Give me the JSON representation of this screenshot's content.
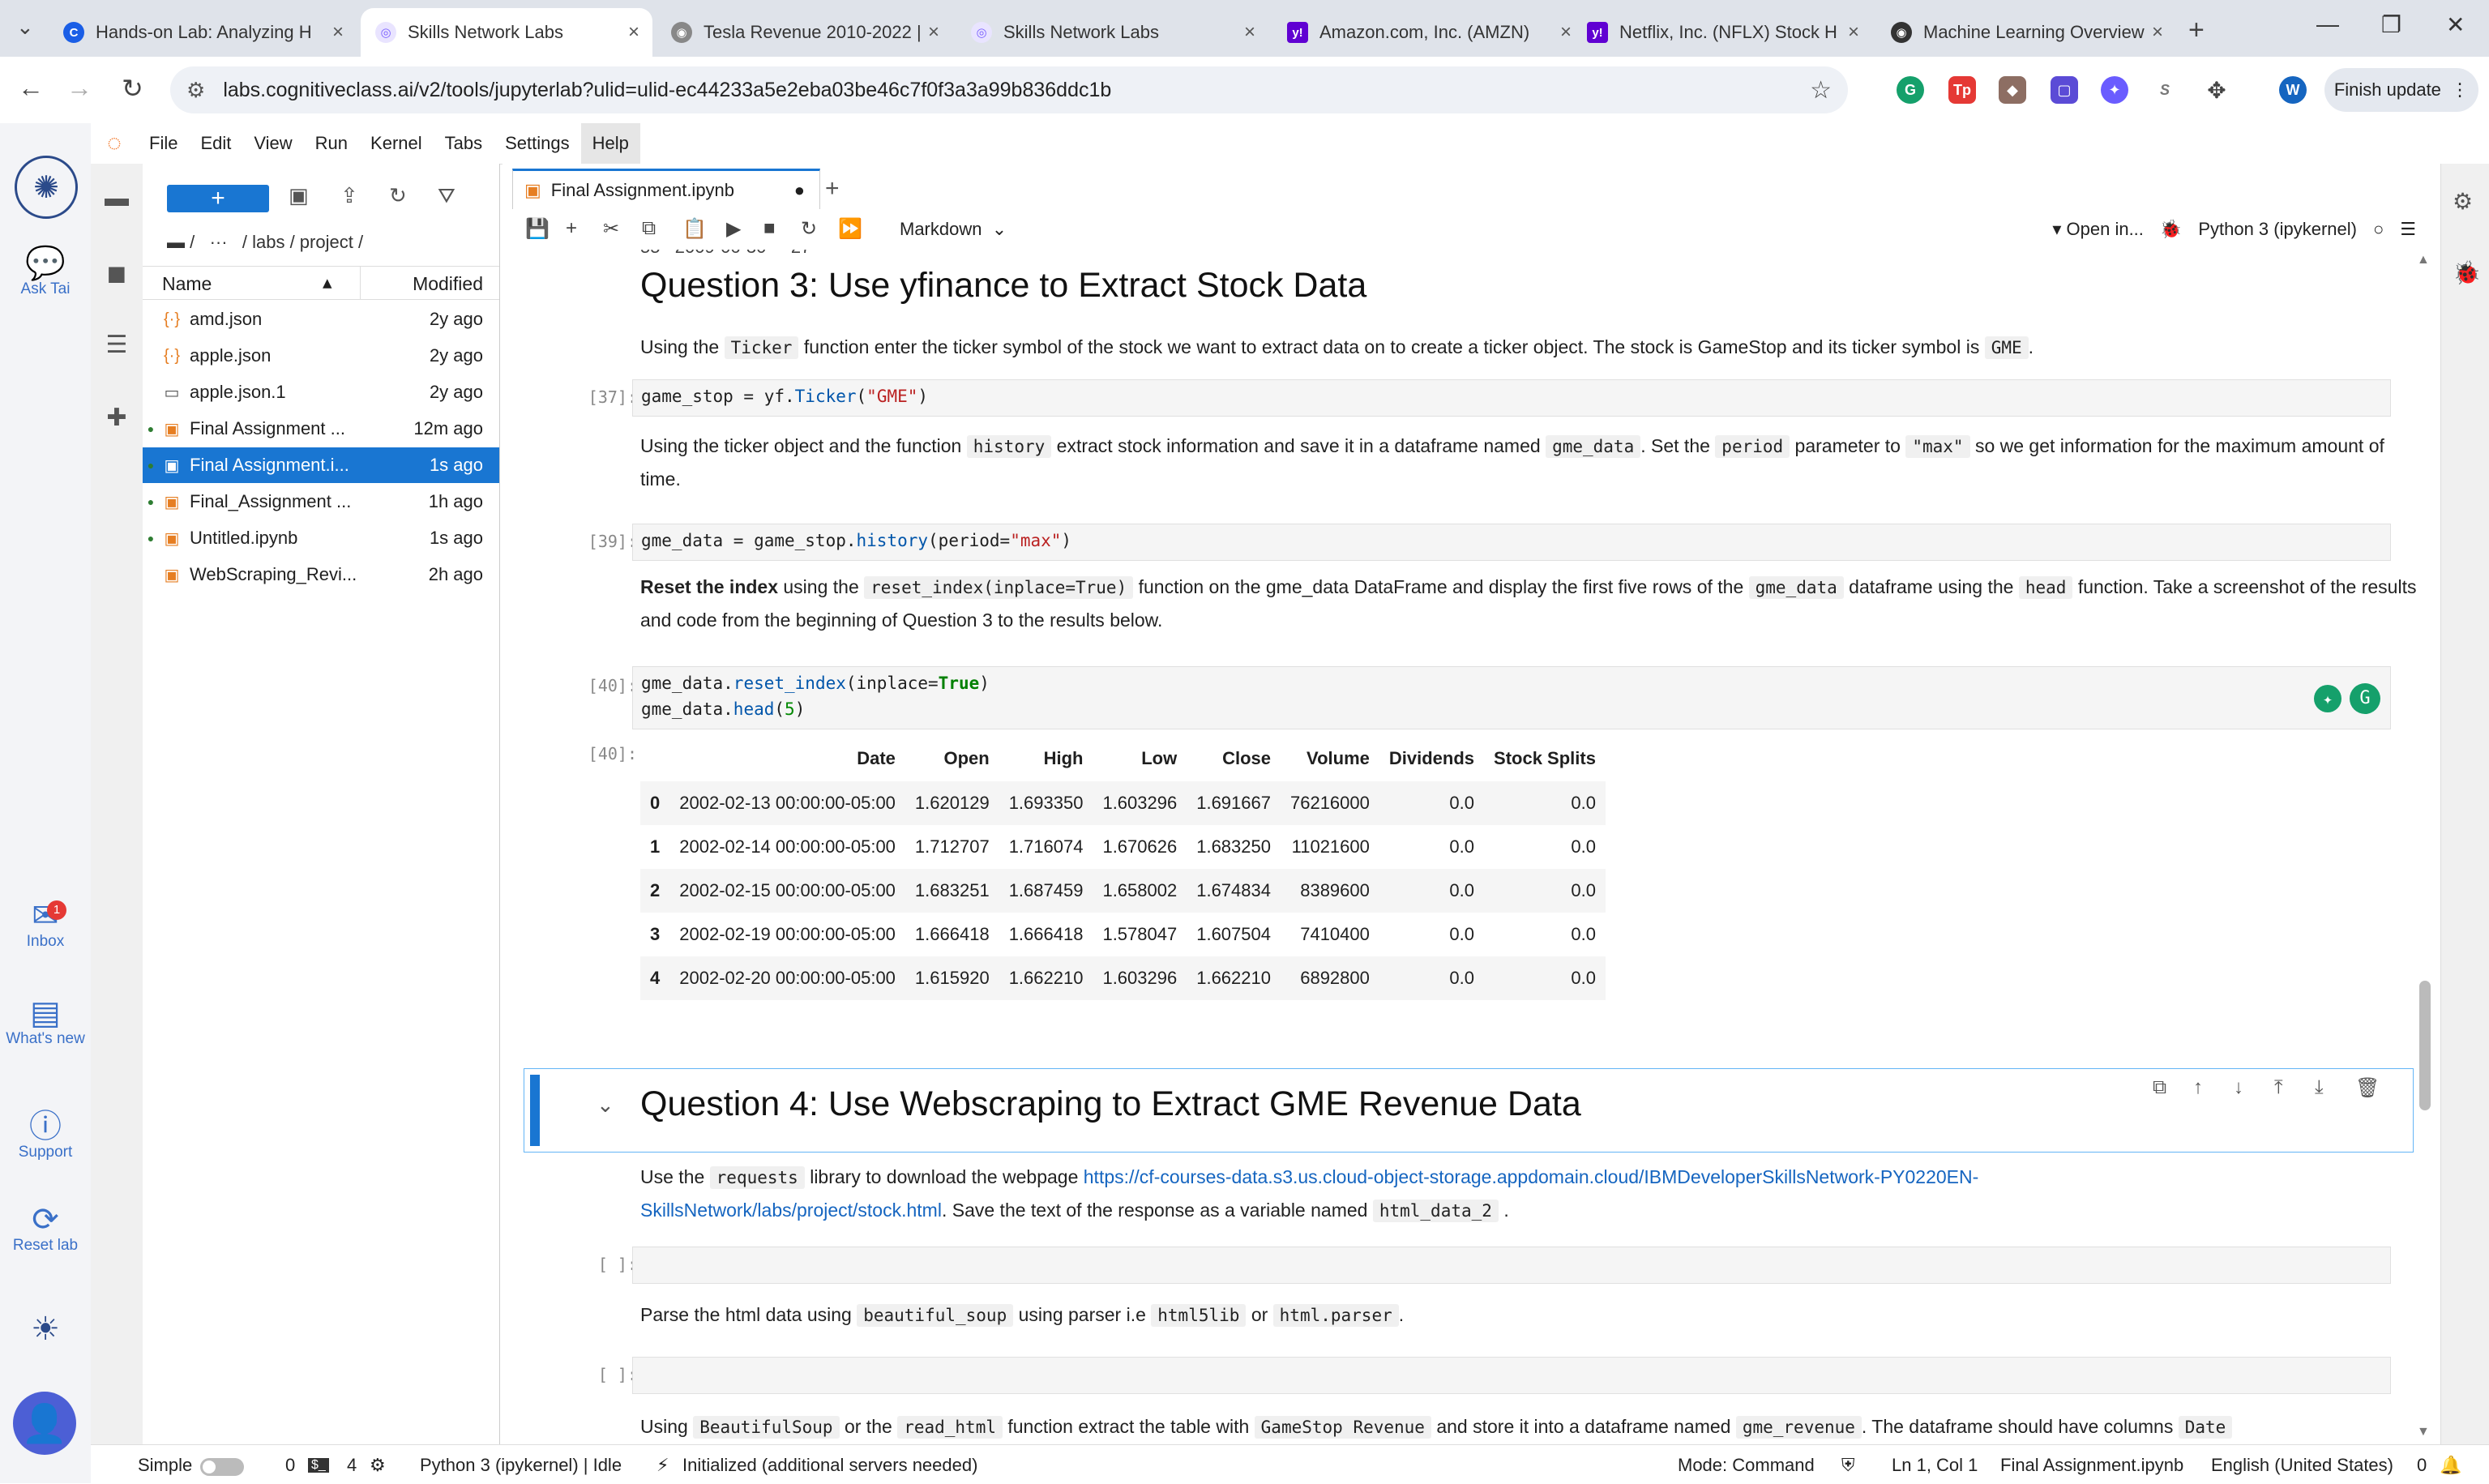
{
  "browser": {
    "tabs": [
      {
        "title": "Hands-on Lab: Analyzing H",
        "favicon": "C",
        "color": "#1a5ee6"
      },
      {
        "title": "Skills Network Labs",
        "favicon": "◎",
        "color": "#7b61ff",
        "active": true
      },
      {
        "title": "Tesla Revenue 2010-2022 |",
        "favicon": "◉",
        "color": "#666666"
      },
      {
        "title": "Skills Network Labs",
        "favicon": "◎",
        "color": "#7b61ff"
      },
      {
        "title": "Amazon.com, Inc. (AMZN)",
        "favicon": "y!",
        "color": "#6001d2"
      },
      {
        "title": "Netflix, Inc. (NFLX) Stock H",
        "favicon": "y!",
        "color": "#6001d2"
      },
      {
        "title": "Machine Learning Overview",
        "favicon": "◉",
        "color": "#222222"
      }
    ],
    "url": "labs.cognitiveclass.ai/v2/tools/jupyterlab?ulid=ulid-ec44233a5e2eba03be46c7f0f3a3a99b836ddc1b",
    "finish_update": "Finish update",
    "profile_initial": "W"
  },
  "rail": {
    "ask": "Ask Tai",
    "inbox": "Inbox",
    "inbox_badge": "1",
    "whats_new": "What's new",
    "support": "Support",
    "reset": "Reset lab"
  },
  "menu": [
    "File",
    "Edit",
    "View",
    "Run",
    "Kernel",
    "Tabs",
    "Settings",
    "Help"
  ],
  "filebrowser": {
    "breadcrumb": "/   ···   / labs / project /",
    "col_name": "Name",
    "col_modified": "Modified",
    "files": [
      {
        "name": "amd.json",
        "modified": "2y ago",
        "type": "json"
      },
      {
        "name": "apple.json",
        "modified": "2y ago",
        "type": "json"
      },
      {
        "name": "apple.json.1",
        "modified": "2y ago",
        "type": "file"
      },
      {
        "name": "Final Assignment ...",
        "modified": "12m ago",
        "type": "nb",
        "running": true
      },
      {
        "name": "Final Assignment.i...",
        "modified": "1s ago",
        "type": "nb",
        "running": true,
        "selected": true
      },
      {
        "name": "Final_Assignment ...",
        "modified": "1h ago",
        "type": "nb",
        "running": true
      },
      {
        "name": "Untitled.ipynb",
        "modified": "1s ago",
        "type": "nb",
        "running": true
      },
      {
        "name": "WebScraping_Revi...",
        "modified": "2h ago",
        "type": "nb"
      }
    ]
  },
  "notebook": {
    "tab_title": "Final Assignment.ipynb",
    "cell_type": "Markdown",
    "open_in": "Open in...",
    "kernel": "Python 3 (ipykernel)",
    "q3_title": "Question 3: Use yfinance to Extract Stock Data",
    "q3_p1_a": "Using the",
    "q3_p1_code1": "Ticker",
    "q3_p1_b": "function enter the ticker symbol of the stock we want to extract data on to create a ticker object. The stock is GameStop and its ticker symbol is",
    "q3_p1_code2": "GME",
    "q3_p1_c": ".",
    "c37_prompt": "[37]:",
    "c37_a": "game_stop = yf.",
    "c37_fn": "Ticker",
    "c37_b": "(",
    "c37_str": "\"GME\"",
    "c37_c": ")",
    "q3_p2_a": "Using the ticker object and the function",
    "q3_p2_code1": "history",
    "q3_p2_b": "extract stock information and save it in a dataframe named",
    "q3_p2_code2": "gme_data",
    "q3_p2_c": ". Set the",
    "q3_p2_code3": "period",
    "q3_p2_d": "parameter to",
    "q3_p2_code4": "\"max\"",
    "q3_p2_e": "so we get information for the maximum amount of time.",
    "c39_prompt": "[39]:",
    "c39_a": "gme_data = game_stop.",
    "c39_fn": "history",
    "c39_b": "(period=",
    "c39_str": "\"max\"",
    "c39_c": ")",
    "q3_p3_bold": "Reset the index",
    "q3_p3_a": "using the",
    "q3_p3_code1": "reset_index(inplace=True)",
    "q3_p3_b": "function on the gme_data DataFrame and display the first five rows of the",
    "q3_p3_code2": "gme_data",
    "q3_p3_c": "dataframe using the",
    "q3_p3_code3": "head",
    "q3_p3_d": "function. Take a screenshot of the results and code from the beginning of Question 3 to the results below.",
    "c40_prompt": "[40]:",
    "c40_l1_a": "gme_data.",
    "c40_l1_fn": "reset_index",
    "c40_l1_b": "(inplace=",
    "c40_l1_kw": "True",
    "c40_l1_c": ")",
    "c40_l2_a": "gme_data.",
    "c40_l2_fn": "head",
    "c40_l2_b": "(",
    "c40_l2_num": "5",
    "c40_l2_c": ")",
    "out40_prompt": "[40]:",
    "table": {
      "columns": [
        "",
        "Date",
        "Open",
        "High",
        "Low",
        "Close",
        "Volume",
        "Dividends",
        "Stock Splits"
      ],
      "rows": [
        [
          "0",
          "2002-02-13 00:00:00-05:00",
          "1.620129",
          "1.693350",
          "1.603296",
          "1.691667",
          "76216000",
          "0.0",
          "0.0"
        ],
        [
          "1",
          "2002-02-14 00:00:00-05:00",
          "1.712707",
          "1.716074",
          "1.670626",
          "1.683250",
          "11021600",
          "0.0",
          "0.0"
        ],
        [
          "2",
          "2002-02-15 00:00:00-05:00",
          "1.683251",
          "1.687459",
          "1.658002",
          "1.674834",
          "8389600",
          "0.0",
          "0.0"
        ],
        [
          "3",
          "2002-02-19 00:00:00-05:00",
          "1.666418",
          "1.666418",
          "1.578047",
          "1.607504",
          "7410400",
          "0.0",
          "0.0"
        ],
        [
          "4",
          "2002-02-20 00:00:00-05:00",
          "1.615920",
          "1.662210",
          "1.603296",
          "1.662210",
          "6892800",
          "0.0",
          "0.0"
        ]
      ]
    },
    "q4_title": "Question 4: Use Webscraping to Extract GME Revenue Data",
    "q4_p1_a": "Use the",
    "q4_p1_code1": "requests",
    "q4_p1_b": "library to download the webpage",
    "q4_p1_link1": "https://cf-courses-data.s3.us.cloud-object-storage.appdomain.cloud/IBMDeveloperSkillsNetwork-PY0220EN-",
    "q4_p1_link2": "SkillsNetwork/labs/project/stock.html",
    "q4_p1_c": ". Save the text of the response as a variable named",
    "q4_p1_code2": "html_data_2",
    "q4_p1_d": ".",
    "empty_prompt": "[ ]:",
    "q4_p2_a": "Parse the html data using",
    "q4_p2_code1": "beautiful_soup",
    "q4_p2_b": "using parser i.e",
    "q4_p2_code2": "html5lib",
    "q4_p2_c": "or",
    "q4_p2_code3": "html.parser",
    "q4_p2_d": ".",
    "q4_p3_a": "Using",
    "q4_p3_code1": "BeautifulSoup",
    "q4_p3_b": "or the",
    "q4_p3_code2": "read_html",
    "q4_p3_c": "function extract the table with",
    "q4_p3_code3": "GameStop Revenue",
    "q4_p3_d": "and store it into a dataframe named",
    "q4_p3_code4": "gme_revenue",
    "q4_p3_e": ". The dataframe should have columns",
    "q4_p3_code5": "Date"
  },
  "status": {
    "mode_simple": "Simple",
    "zero": "0",
    "four": "4",
    "kernel_state": "Python 3 (ipykernel) | Idle",
    "init": "Initialized (additional servers needed)",
    "mode": "Mode: Command",
    "position": "Ln 1, Col 1",
    "file": "Final Assignment.ipynb",
    "language": "English (United States)",
    "notif": "0"
  }
}
